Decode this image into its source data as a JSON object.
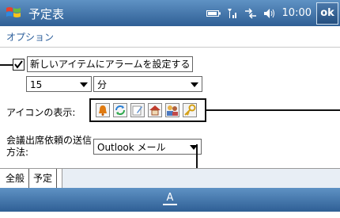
{
  "titlebar": {
    "app_title": "予定表",
    "time": "10:00",
    "ok_label": "ok",
    "icons": [
      "windows-flag-icon",
      "battery-icon",
      "signal-icon",
      "connectivity-icon",
      "volume-icon"
    ]
  },
  "subheader": {
    "title": "オプション"
  },
  "alarm": {
    "checked": true,
    "label": "新しいアイテムにアラームを設定する"
  },
  "alarm_time": {
    "value": "15",
    "unit": "分"
  },
  "icon_display": {
    "label": "アイコンの表示:",
    "icons": [
      "bell-icon",
      "recurrence-icon",
      "note-icon",
      "home-icon",
      "people-icon",
      "key-icon"
    ]
  },
  "meeting": {
    "label": "会議出席依頼の送信方法:",
    "value": "Outlook メール"
  },
  "tabs": [
    {
      "label": "全般"
    },
    {
      "label": "予定"
    }
  ],
  "softkeys": {
    "input_icon": "keyboard-input-icon"
  },
  "colors": {
    "titlebar": "#2f5f95",
    "link": "#2a5d9a",
    "bell": "#e07a10",
    "recurrence": "#2a7fd4",
    "home": "#c0392b"
  }
}
